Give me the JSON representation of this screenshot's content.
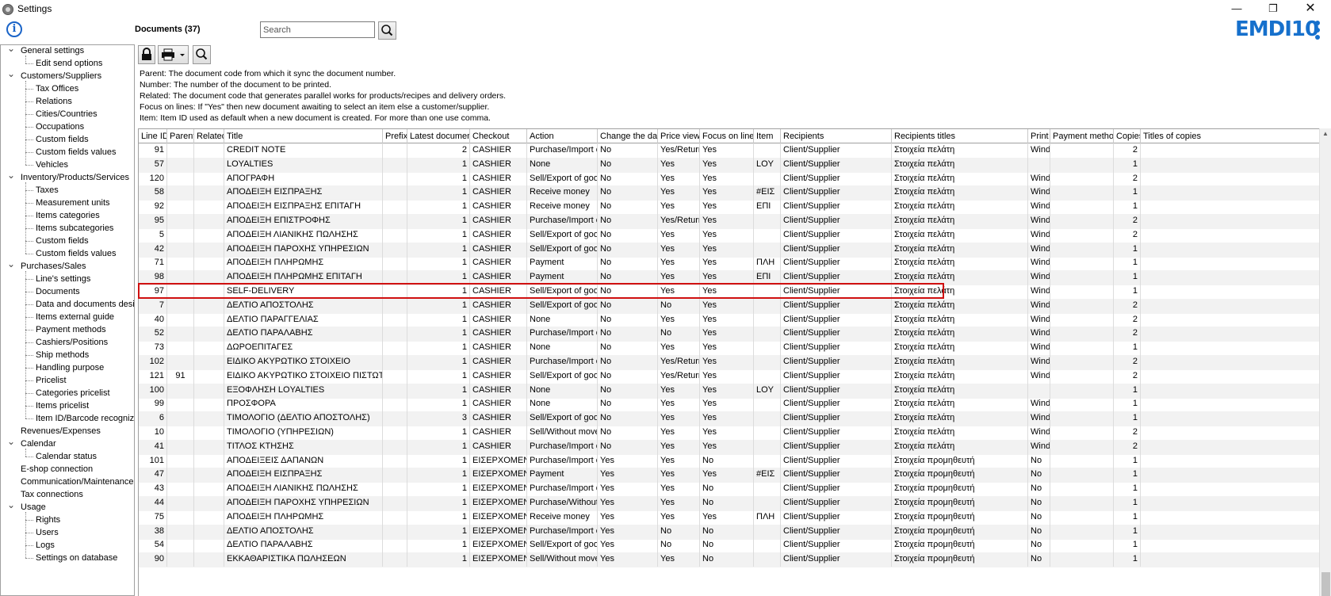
{
  "window": {
    "title": "Settings",
    "minimize": "—",
    "maximize": "❐",
    "close": "✕"
  },
  "brand": {
    "logo_text": "EMDI10"
  },
  "tree": [
    {
      "label": "General settings",
      "level": 0,
      "expandable": true
    },
    {
      "label": "Edit send options",
      "level": 1
    },
    {
      "label": "Customers/Suppliers",
      "level": 0,
      "expandable": true
    },
    {
      "label": "Tax Offices",
      "level": 1
    },
    {
      "label": "Relations",
      "level": 1
    },
    {
      "label": "Cities/Countries",
      "level": 1
    },
    {
      "label": "Occupations",
      "level": 1
    },
    {
      "label": "Custom fields",
      "level": 1
    },
    {
      "label": "Custom fields values",
      "level": 1
    },
    {
      "label": "Vehicles",
      "level": 1
    },
    {
      "label": "Inventory/Products/Services",
      "level": 0,
      "expandable": true
    },
    {
      "label": "Taxes",
      "level": 1
    },
    {
      "label": "Measurement units",
      "level": 1
    },
    {
      "label": "Items categories",
      "level": 1
    },
    {
      "label": "Items subcategories",
      "level": 1
    },
    {
      "label": "Custom fields",
      "level": 1
    },
    {
      "label": "Custom fields values",
      "level": 1
    },
    {
      "label": "Purchases/Sales",
      "level": 0,
      "expandable": true
    },
    {
      "label": "Line's settings",
      "level": 1
    },
    {
      "label": "Documents",
      "level": 1
    },
    {
      "label": "Data and documents design",
      "level": 1
    },
    {
      "label": "Items external guide",
      "level": 1
    },
    {
      "label": "Payment methods",
      "level": 1
    },
    {
      "label": "Cashiers/Positions",
      "level": 1
    },
    {
      "label": "Ship methods",
      "level": 1
    },
    {
      "label": "Handling purpose",
      "level": 1
    },
    {
      "label": "Pricelist",
      "level": 1
    },
    {
      "label": "Categories pricelist",
      "level": 1
    },
    {
      "label": "Items pricelist",
      "level": 1
    },
    {
      "label": "Item ID/Barcode recognizer",
      "level": 1
    },
    {
      "label": "Revenues/Expenses",
      "level": 0
    },
    {
      "label": "Calendar",
      "level": 0,
      "expandable": true
    },
    {
      "label": "Calendar status",
      "level": 1
    },
    {
      "label": "E-shop connection",
      "level": 0
    },
    {
      "label": "Communication/Maintenance",
      "level": 0
    },
    {
      "label": "Tax connections",
      "level": 0
    },
    {
      "label": "Usage",
      "level": 0,
      "expandable": true
    },
    {
      "label": "Rights",
      "level": 1
    },
    {
      "label": "Users",
      "level": 1
    },
    {
      "label": "Logs",
      "level": 1
    },
    {
      "label": "Settings on database",
      "level": 1
    }
  ],
  "documents": {
    "title": "Documents (37)"
  },
  "search": {
    "placeholder": "Search"
  },
  "help_lines": [
    "Parent: The document code from which it sync the document number.",
    "Number: The number of the document to be printed.",
    "Related: The document code that generates parallel works for products/recipes and delivery orders.",
    "Focus on lines: If \"Yes\" then new document awaiting to select an item else a customer/supplier.",
    "Item: Item ID used as default when a new document is created. For more than one use comma."
  ],
  "columns": [
    "Line ID",
    "Parent",
    "Related",
    "Title",
    "Prefix",
    "Latest document",
    "Checkout",
    "Action",
    "Change the day",
    "Price view",
    "Focus on lines",
    "Item",
    "Recipients",
    "Recipients titles",
    "Print",
    "Payment method",
    "Copies",
    "Titles of copies"
  ],
  "rows": [
    [
      "91",
      "",
      "",
      "CREDIT NOTE",
      "",
      "2",
      "CASHIER",
      "Purchase/Import of",
      "No",
      "Yes/Return",
      "Yes",
      "",
      "Client/Supplier",
      "Στοιχεία πελάτη",
      "Wind",
      "",
      "2",
      ""
    ],
    [
      "57",
      "",
      "",
      "LOYALTIES",
      "",
      "1",
      "CASHIER",
      "None",
      "No",
      "Yes",
      "Yes",
      "LOY",
      "Client/Supplier",
      "Στοιχεία πελάτη",
      "",
      "",
      "1",
      ""
    ],
    [
      "120",
      "",
      "",
      "ΑΠΟΓΡΑΦΗ",
      "",
      "1",
      "CASHIER",
      "Sell/Export of good",
      "No",
      "Yes",
      "Yes",
      "",
      "Client/Supplier",
      "Στοιχεία πελάτη",
      "Wind",
      "",
      "2",
      ""
    ],
    [
      "58",
      "",
      "",
      "ΑΠΟΔΕΙΞΗ ΕΙΣΠΡΑΞΗΣ",
      "",
      "1",
      "CASHIER",
      "Receive money",
      "No",
      "Yes",
      "Yes",
      "#ΕΙΣ",
      "Client/Supplier",
      "Στοιχεία πελάτη",
      "Wind",
      "",
      "1",
      ""
    ],
    [
      "92",
      "",
      "",
      "ΑΠΟΔΕΙΞΗ ΕΙΣΠΡΑΞΗΣ ΕΠΙΤΑΓΗ",
      "",
      "1",
      "CASHIER",
      "Receive money",
      "No",
      "Yes",
      "Yes",
      "ΕΠΙ",
      "Client/Supplier",
      "Στοιχεία πελάτη",
      "Wind",
      "",
      "1",
      ""
    ],
    [
      "95",
      "",
      "",
      "ΑΠΟΔΕΙΞΗ ΕΠΙΣΤΡΟΦΗΣ",
      "",
      "1",
      "CASHIER",
      "Purchase/Import of",
      "No",
      "Yes/Return",
      "Yes",
      "",
      "Client/Supplier",
      "Στοιχεία πελάτη",
      "Wind",
      "",
      "2",
      ""
    ],
    [
      "5",
      "",
      "",
      "ΑΠΟΔΕΙΞΗ ΛΙΑΝΙΚΗΣ ΠΩΛΗΣΗΣ",
      "",
      "1",
      "CASHIER",
      "Sell/Export of good",
      "No",
      "Yes",
      "Yes",
      "",
      "Client/Supplier",
      "Στοιχεία πελάτη",
      "Wind",
      "",
      "2",
      ""
    ],
    [
      "42",
      "",
      "",
      "ΑΠΟΔΕΙΞΗ ΠΑΡΟΧΗΣ ΥΠΗΡΕΣΙΩΝ",
      "",
      "1",
      "CASHIER",
      "Sell/Export of good",
      "No",
      "Yes",
      "Yes",
      "",
      "Client/Supplier",
      "Στοιχεία πελάτη",
      "Wind",
      "",
      "1",
      ""
    ],
    [
      "71",
      "",
      "",
      "ΑΠΟΔΕΙΞΗ ΠΛΗΡΩΜΗΣ",
      "",
      "1",
      "CASHIER",
      "Payment",
      "No",
      "Yes",
      "Yes",
      "ΠΛΗ",
      "Client/Supplier",
      "Στοιχεία πελάτη",
      "Wind",
      "",
      "1",
      ""
    ],
    [
      "98",
      "",
      "",
      "ΑΠΟΔΕΙΞΗ ΠΛΗΡΩΜΗΣ ΕΠΙΤΑΓΗ",
      "",
      "1",
      "CASHIER",
      "Payment",
      "No",
      "Yes",
      "Yes",
      "ΕΠΙ",
      "Client/Supplier",
      "Στοιχεία πελάτη",
      "Wind",
      "",
      "1",
      ""
    ],
    [
      "97",
      "",
      "",
      "SELF-DELIVERY",
      "",
      "1",
      "CASHIER",
      "Sell/Export of good",
      "No",
      "Yes",
      "Yes",
      "",
      "Client/Supplier",
      "Στοιχεία πελάτη",
      "Wind",
      "",
      "1",
      ""
    ],
    [
      "7",
      "",
      "",
      "ΔΕΛΤΙΟ ΑΠΟΣΤΟΛΗΣ",
      "",
      "1",
      "CASHIER",
      "Sell/Export of good",
      "No",
      "No",
      "Yes",
      "",
      "Client/Supplier",
      "Στοιχεία πελάτη",
      "Wind",
      "",
      "2",
      ""
    ],
    [
      "40",
      "",
      "",
      "ΔΕΛΤΙΟ ΠΑΡΑΓΓΕΛΙΑΣ",
      "",
      "1",
      "CASHIER",
      "None",
      "No",
      "Yes",
      "Yes",
      "",
      "Client/Supplier",
      "Στοιχεία πελάτη",
      "Wind",
      "",
      "2",
      ""
    ],
    [
      "52",
      "",
      "",
      "ΔΕΛΤΙΟ ΠΑΡΑΛΑΒΗΣ",
      "",
      "1",
      "CASHIER",
      "Purchase/Import of",
      "No",
      "No",
      "Yes",
      "",
      "Client/Supplier",
      "Στοιχεία πελάτη",
      "Wind",
      "",
      "2",
      ""
    ],
    [
      "73",
      "",
      "",
      "ΔΩΡΟΕΠΙΤΑΓΕΣ",
      "",
      "1",
      "CASHIER",
      "None",
      "No",
      "Yes",
      "Yes",
      "",
      "Client/Supplier",
      "Στοιχεία πελάτη",
      "Wind",
      "",
      "1",
      ""
    ],
    [
      "102",
      "",
      "",
      "ΕΙΔΙΚΟ ΑΚΥΡΩΤΙΚΟ ΣΤΟΙΧΕΙΟ",
      "",
      "1",
      "CASHIER",
      "Purchase/Import of",
      "No",
      "Yes/Return",
      "Yes",
      "",
      "Client/Supplier",
      "Στοιχεία πελάτη",
      "Wind",
      "",
      "2",
      ""
    ],
    [
      "121",
      "91",
      "",
      "ΕΙΔΙΚΟ ΑΚΥΡΩΤΙΚΟ ΣΤΟΙΧΕΙΟ ΠΙΣΤΩΤΙΚΟ",
      "",
      "1",
      "CASHIER",
      "Sell/Export of good",
      "No",
      "Yes/Return",
      "Yes",
      "",
      "Client/Supplier",
      "Στοιχεία πελάτη",
      "Wind",
      "",
      "2",
      ""
    ],
    [
      "100",
      "",
      "",
      "ΕΞΟΦΛΗΣΗ LOYALTIES",
      "",
      "1",
      "CASHIER",
      "None",
      "No",
      "Yes",
      "Yes",
      "LOY",
      "Client/Supplier",
      "Στοιχεία πελάτη",
      "",
      "",
      "1",
      ""
    ],
    [
      "99",
      "",
      "",
      "ΠΡΟΣΦΟΡΑ",
      "",
      "1",
      "CASHIER",
      "None",
      "No",
      "Yes",
      "Yes",
      "",
      "Client/Supplier",
      "Στοιχεία πελάτη",
      "Wind",
      "",
      "1",
      ""
    ],
    [
      "6",
      "",
      "",
      "ΤΙΜΟΛΟΓΙΟ (ΔΕΛΤΙΟ ΑΠΟΣΤΟΛΗΣ)",
      "",
      "3",
      "CASHIER",
      "Sell/Export of good",
      "No",
      "Yes",
      "Yes",
      "",
      "Client/Supplier",
      "Στοιχεία πελάτη",
      "Wind",
      "",
      "1",
      ""
    ],
    [
      "10",
      "",
      "",
      "ΤΙΜΟΛΟΓΙΟ (ΥΠΗΡΕΣΙΩΝ)",
      "",
      "1",
      "CASHIER",
      "Sell/Without movem",
      "No",
      "Yes",
      "Yes",
      "",
      "Client/Supplier",
      "Στοιχεία πελάτη",
      "Wind",
      "",
      "2",
      ""
    ],
    [
      "41",
      "",
      "",
      "ΤΙΤΛΟΣ ΚΤΗΣΗΣ",
      "",
      "1",
      "CASHIER",
      "Purchase/Import of",
      "No",
      "Yes",
      "Yes",
      "",
      "Client/Supplier",
      "Στοιχεία πελάτη",
      "Wind",
      "",
      "2",
      ""
    ],
    [
      "101",
      "",
      "",
      "ΑΠΟΔΕΙΞΕΙΣ ΔΑΠΑΝΩΝ",
      "",
      "1",
      "ΕΙΣΕΡΧΟΜΕΝΑ",
      "Purchase/Import of",
      "Yes",
      "Yes",
      "No",
      "",
      "Client/Supplier",
      "Στοιχεία προμηθευτή",
      "No",
      "",
      "1",
      ""
    ],
    [
      "47",
      "",
      "",
      "ΑΠΟΔΕΙΞΗ ΕΙΣΠΡΑΞΗΣ",
      "",
      "1",
      "ΕΙΣΕΡΧΟΜΕΝΑ",
      "Payment",
      "Yes",
      "Yes",
      "Yes",
      "#ΕΙΣ",
      "Client/Supplier",
      "Στοιχεία προμηθευτή",
      "No",
      "",
      "1",
      ""
    ],
    [
      "43",
      "",
      "",
      "ΑΠΟΔΕΙΞΗ ΛΙΑΝΙΚΗΣ ΠΩΛΗΣΗΣ",
      "",
      "1",
      "ΕΙΣΕΡΧΟΜΕΝΑ",
      "Purchase/Import of",
      "Yes",
      "Yes",
      "No",
      "",
      "Client/Supplier",
      "Στοιχεία προμηθευτή",
      "No",
      "",
      "1",
      ""
    ],
    [
      "44",
      "",
      "",
      "ΑΠΟΔΕΙΞΗ ΠΑΡΟΧΗΣ ΥΠΗΡΕΣΙΩΝ",
      "",
      "1",
      "ΕΙΣΕΡΧΟΜΕΝΑ",
      "Purchase/Without m",
      "Yes",
      "Yes",
      "No",
      "",
      "Client/Supplier",
      "Στοιχεία προμηθευτή",
      "No",
      "",
      "1",
      ""
    ],
    [
      "75",
      "",
      "",
      "ΑΠΟΔΕΙΞΗ ΠΛΗΡΩΜΗΣ",
      "",
      "1",
      "ΕΙΣΕΡΧΟΜΕΝΑ",
      "Receive money",
      "Yes",
      "Yes",
      "Yes",
      "ΠΛΗ",
      "Client/Supplier",
      "Στοιχεία προμηθευτή",
      "No",
      "",
      "1",
      ""
    ],
    [
      "38",
      "",
      "",
      "ΔΕΛΤΙΟ ΑΠΟΣΤΟΛΗΣ",
      "",
      "1",
      "ΕΙΣΕΡΧΟΜΕΝΑ",
      "Purchase/Import of",
      "Yes",
      "No",
      "No",
      "",
      "Client/Supplier",
      "Στοιχεία προμηθευτή",
      "No",
      "",
      "1",
      ""
    ],
    [
      "54",
      "",
      "",
      "ΔΕΛΤΙΟ ΠΑΡΑΛΑΒΗΣ",
      "",
      "1",
      "ΕΙΣΕΡΧΟΜΕΝΑ",
      "Sell/Export of good",
      "Yes",
      "No",
      "No",
      "",
      "Client/Supplier",
      "Στοιχεία προμηθευτή",
      "No",
      "",
      "1",
      ""
    ],
    [
      "90",
      "",
      "",
      "ΕΚΚΑΘΑΡΙΣΤΙΚΑ ΠΩΛΗΣΕΩΝ",
      "",
      "1",
      "ΕΙΣΕΡΧΟΜΕΝΑ",
      "Sell/Without movem",
      "Yes",
      "Yes",
      "No",
      "",
      "Client/Supplier",
      "Στοιχεία προμηθευτή",
      "No",
      "",
      "1",
      ""
    ]
  ],
  "selected_row": 10,
  "colors": {
    "accent": "#1670cc",
    "highlight_border": "#d01010",
    "row_alt": "#f2f2f2"
  }
}
